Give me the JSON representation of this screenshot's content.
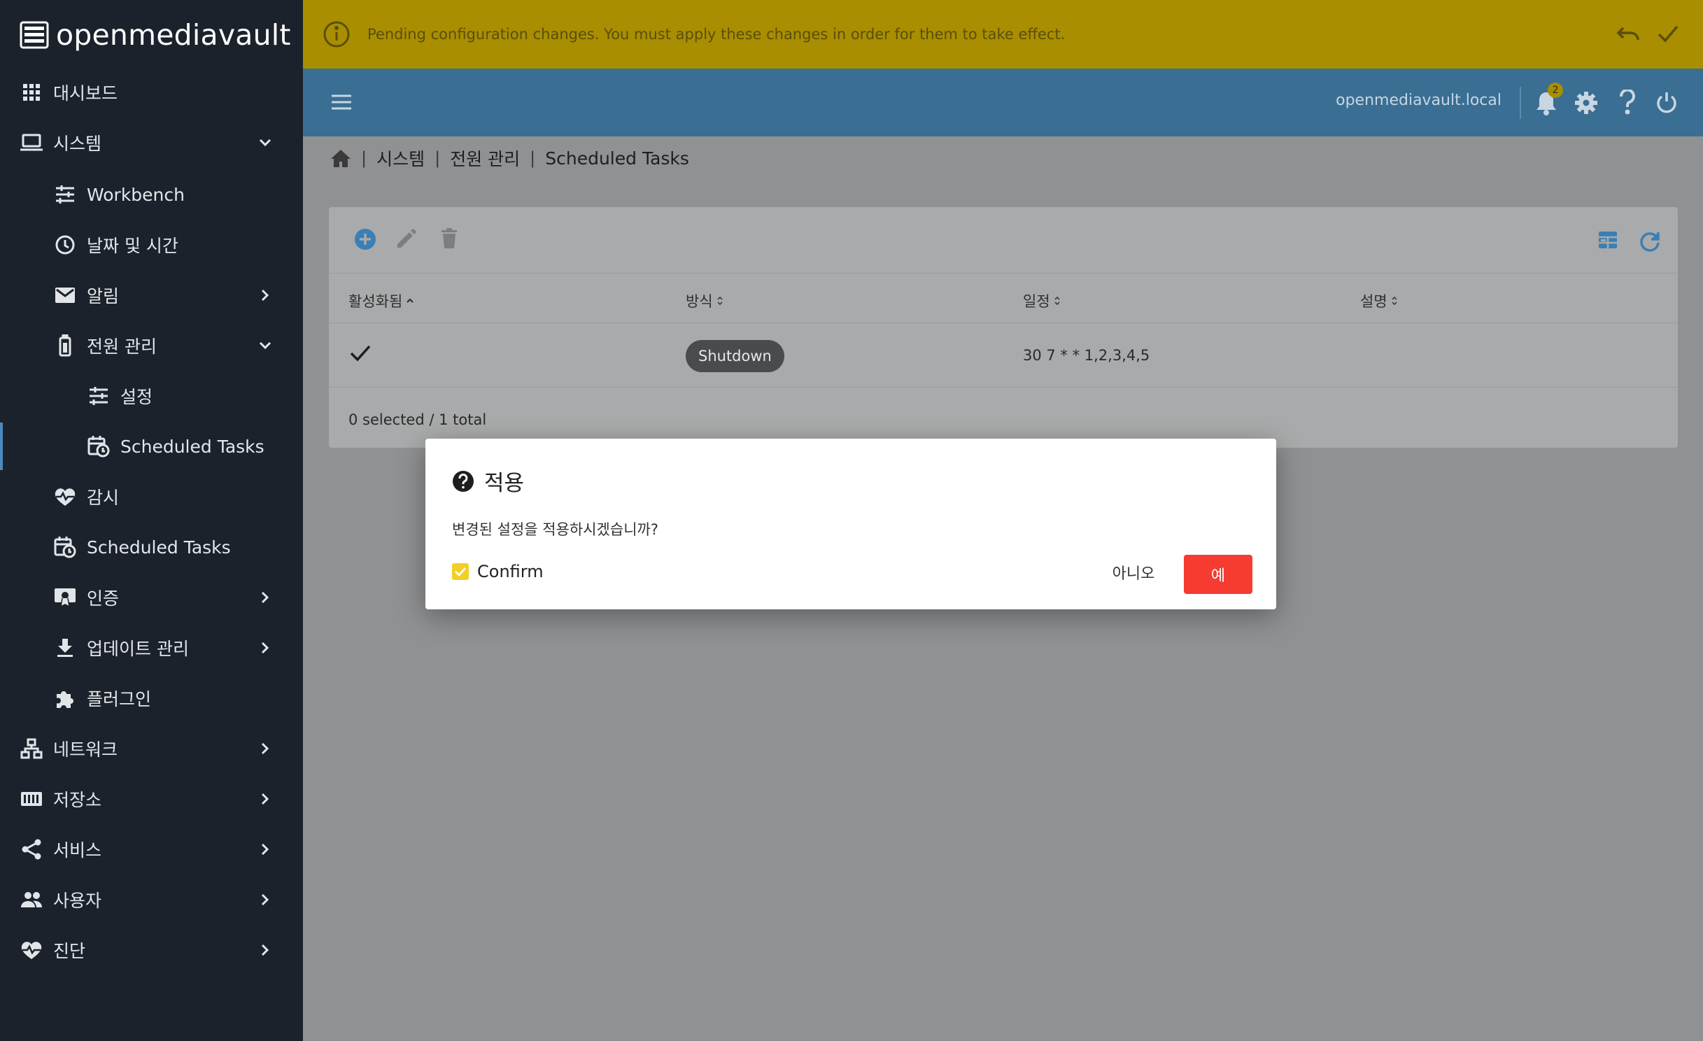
{
  "app": {
    "name": "openmediavault"
  },
  "banner": {
    "message": "Pending configuration changes. You must apply these changes in order for them to take effect."
  },
  "header": {
    "hostname": "openmediavault.local",
    "notification_count": "2"
  },
  "sidebar": {
    "items": [
      {
        "label": "대시보드"
      },
      {
        "label": "시스템"
      },
      {
        "label": "Workbench"
      },
      {
        "label": "날짜 및 시간"
      },
      {
        "label": "알림"
      },
      {
        "label": "전원 관리"
      },
      {
        "label": "설정"
      },
      {
        "label": "Scheduled Tasks"
      },
      {
        "label": "감시"
      },
      {
        "label": "Scheduled Tasks"
      },
      {
        "label": "인증"
      },
      {
        "label": "업데이트 관리"
      },
      {
        "label": "플러그인"
      },
      {
        "label": "네트워크"
      },
      {
        "label": "저장소"
      },
      {
        "label": "서비스"
      },
      {
        "label": "사용자"
      },
      {
        "label": "진단"
      }
    ]
  },
  "breadcrumb": {
    "items": [
      "시스템",
      "전원 관리",
      "Scheduled Tasks"
    ]
  },
  "table": {
    "columns": [
      "활성화됨",
      "방식",
      "일정",
      "설명"
    ],
    "rows": [
      {
        "enabled": true,
        "method": "Shutdown",
        "schedule": "30 7 * * 1,2,3,4,5",
        "description": ""
      }
    ],
    "footer": "0 selected / 1 total"
  },
  "dialog": {
    "title": "적용",
    "message": "변경된 설정을 적용하시겠습니까?",
    "confirm_label": "Confirm",
    "confirm_checked": true,
    "no_label": "아니오",
    "yes_label": "예"
  },
  "colors": {
    "sidebar_bg": "#1b222b",
    "banner_bg": "#a88e00",
    "header_bg": "#3a6e93",
    "accent": "#4a89c0",
    "yes_button": "#f63b30",
    "checkbox": "#f1cf26"
  }
}
